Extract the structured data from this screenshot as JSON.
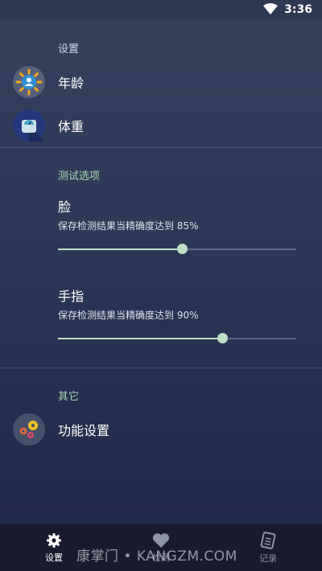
{
  "status": {
    "time": "3:36",
    "wifi_icon": "wifi-icon"
  },
  "sections": {
    "settings": {
      "header": "设置"
    },
    "test_options": {
      "header": "测试选项"
    },
    "other": {
      "header": "其它"
    }
  },
  "items": {
    "age": {
      "label": "年龄",
      "icon": "age-icon"
    },
    "weight": {
      "label": "体重",
      "icon": "scale-icon"
    },
    "function_settings": {
      "label": "功能设置",
      "icon": "gears-icon"
    }
  },
  "sliders": {
    "face": {
      "title": "脸",
      "description": "保存检测结果当精确度达到 85%",
      "value": 0.52
    },
    "finger": {
      "title": "手指",
      "description": "保存检测结果当精确度达到 90%",
      "value": 0.69
    }
  },
  "bottom_nav": {
    "settings": {
      "label": "设置",
      "icon": "gear-icon",
      "active": true
    },
    "detect": {
      "label": "检测",
      "icon": "heart-icon",
      "active": false
    },
    "records": {
      "label": "记录",
      "icon": "notes-icon",
      "active": false
    }
  },
  "watermark": "康掌门 • KANGZM.COM",
  "colors": {
    "accent": "#bfe0c8",
    "section_header": "#a8d8b5",
    "nav_bg": "#191a2e"
  }
}
